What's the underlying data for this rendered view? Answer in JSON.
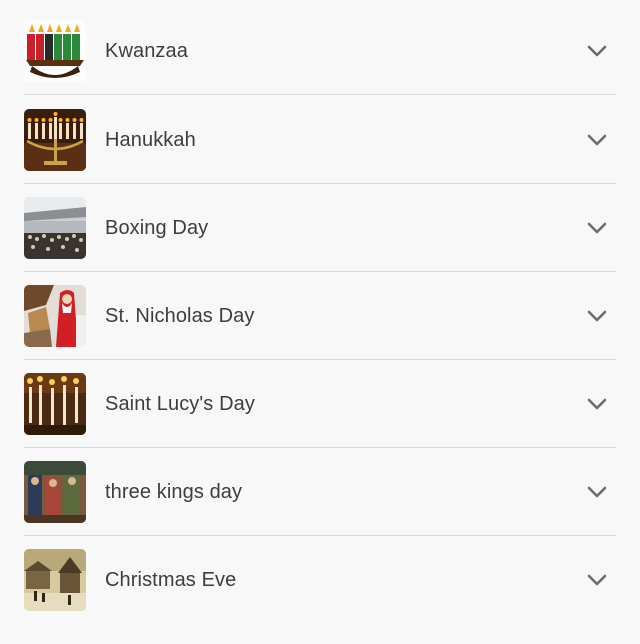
{
  "holidays": {
    "items": [
      {
        "label": "Kwanzaa",
        "thumb": "kwanzaa-kinara-image"
      },
      {
        "label": "Hanukkah",
        "thumb": "hanukkah-menorah-image"
      },
      {
        "label": "Boxing Day",
        "thumb": "boxing-day-mall-image"
      },
      {
        "label": "St. Nicholas Day",
        "thumb": "st-nicholas-image"
      },
      {
        "label": "Saint Lucy's Day",
        "thumb": "saint-lucy-candles-image"
      },
      {
        "label": "three kings day",
        "thumb": "three-kings-tapestry-image"
      },
      {
        "label": "Christmas Eve",
        "thumb": "christmas-eve-village-image"
      }
    ],
    "expand_icon": "chevron-down-icon"
  },
  "colors": {
    "background": "#f8f8f8",
    "text": "#3d3d3d",
    "divider": "#d9d9d9",
    "chevron": "#6b6b6b"
  }
}
